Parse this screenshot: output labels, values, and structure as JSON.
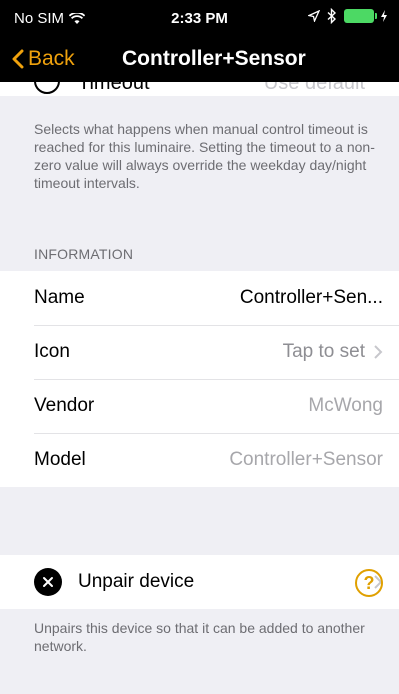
{
  "status_bar": {
    "carrier": "No SIM",
    "time": "2:33 PM"
  },
  "nav": {
    "back_label": "Back",
    "title": "Controller+Sensor"
  },
  "timeout_row": {
    "label": "Timeout",
    "value": "Use default"
  },
  "timeout_footer": "Selects what happens when manual control timeout is reached for this luminaire. Setting the timeout to a non-zero value will always override the weekday day/night timeout intervals.",
  "information": {
    "header": "INFORMATION",
    "rows": [
      {
        "label": "Name",
        "value": "Controller+Sen..."
      },
      {
        "label": "Icon",
        "value": "Tap to set"
      },
      {
        "label": "Vendor",
        "value": "McWong"
      },
      {
        "label": "Model",
        "value": "Controller+Sensor"
      }
    ]
  },
  "unpair": {
    "label": "Unpair device",
    "footer": "Unpairs this device so that it can be added to another network."
  },
  "help_label": "?",
  "colors": {
    "accent": "#f0a20d",
    "nav_bg": "#000000",
    "page_bg": "#efeff4",
    "help": "#e0a000"
  }
}
